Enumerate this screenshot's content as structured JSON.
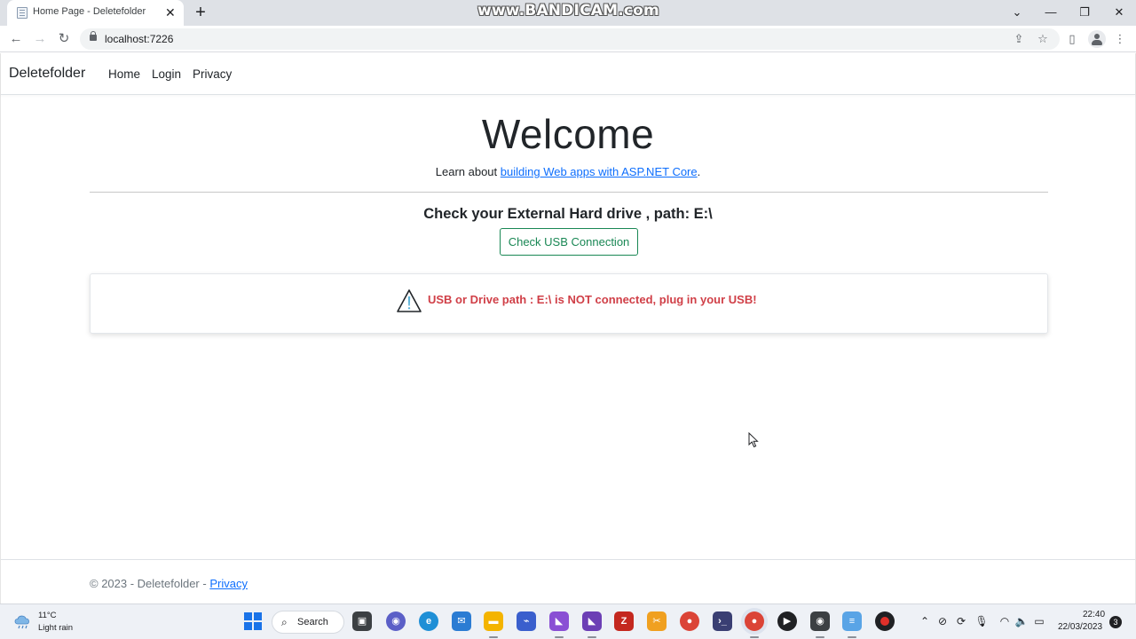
{
  "browser": {
    "tab_title": "Home Page - Deletefolder",
    "tab_close": "✕",
    "new_tab": "+",
    "url": "localhost:7226",
    "watermark": "www.BANDICAM.com"
  },
  "navbar": {
    "brand": "Deletefolder",
    "links": [
      "Home",
      "Login",
      "Privacy"
    ]
  },
  "main": {
    "heading": "Welcome",
    "learn_prefix": "Learn about ",
    "learn_link": "building Web apps with ASP.NET Core",
    "learn_suffix": ".",
    "check_heading": "Check your External Hard drive , path: E:\\",
    "check_button": "Check USB Connection",
    "alert_message": "USB or Drive path : E:\\ is NOT connected, plug in your USB!"
  },
  "footer": {
    "copyright": "© 2023 - Deletefolder - ",
    "privacy_link": "Privacy"
  },
  "taskbar": {
    "weather_temp": "11°C",
    "weather_desc": "Light rain",
    "search_label": "Search",
    "time": "22:40",
    "date": "22/03/2023",
    "notification_count": "3",
    "apps": [
      "task-view",
      "chat",
      "edge",
      "mail",
      "file-explorer",
      "visual-studio-code-purple",
      "visual-studio",
      "visual-studio-2",
      "filezilla",
      "snip-tool",
      "chrome",
      "terminal",
      "chrome-active",
      "media-player",
      "obs",
      "notepad",
      "bandicam-record"
    ]
  },
  "colors": {
    "link": "#0d6efd",
    "success": "#198754",
    "danger": "#d03f47",
    "tab_strip": "#dee1e6"
  }
}
